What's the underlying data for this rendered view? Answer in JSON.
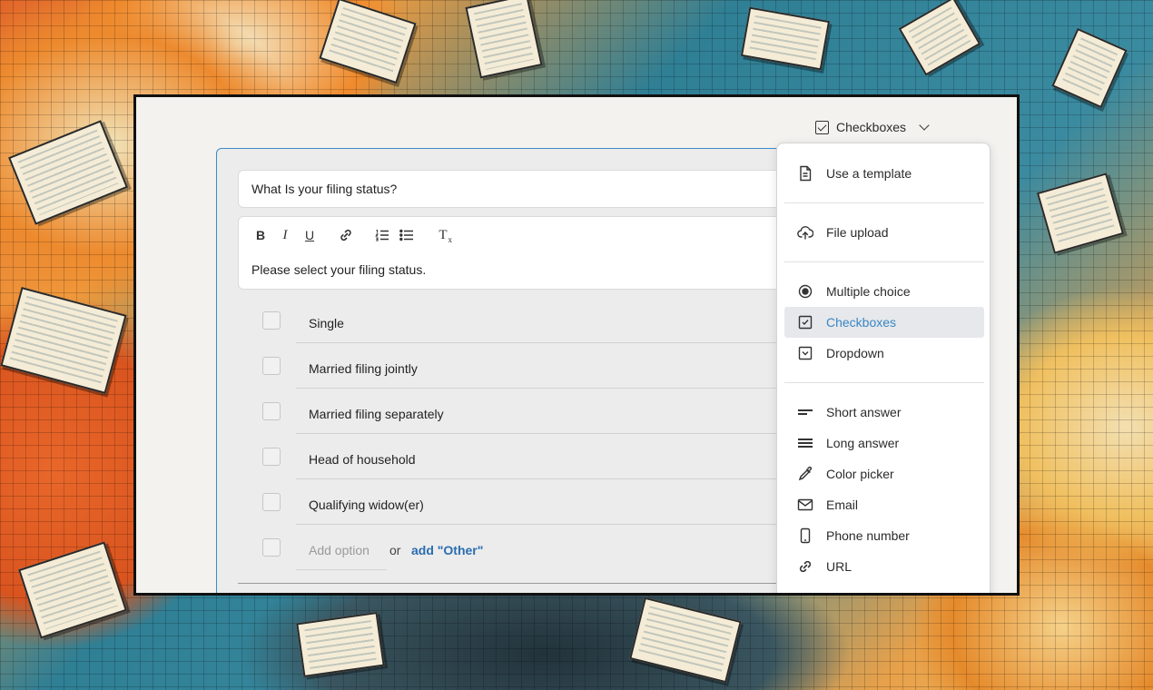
{
  "header": {
    "type_selector_label": "Checkboxes"
  },
  "question": {
    "title": "What Is your filing status?",
    "description": "Please select your filing status.",
    "toolbar": [
      "bold",
      "italic",
      "underline",
      "link",
      "numbered-list",
      "bulleted-list",
      "clear-format"
    ],
    "toolbar_glyphs": {
      "bold": "B",
      "italic": "I",
      "underline": "U",
      "clear": "T"
    }
  },
  "options": [
    {
      "label": "Single"
    },
    {
      "label": "Married filing jointly"
    },
    {
      "label": "Married filing separately"
    },
    {
      "label": "Head of household"
    },
    {
      "label": "Qualifying widow(er)"
    }
  ],
  "add_option": {
    "placeholder": "Add option",
    "or_text": "or",
    "other_link": "add \"Other\""
  },
  "menu": {
    "items": [
      {
        "label": "Use a template",
        "icon": "document-icon"
      },
      {
        "label": "File upload",
        "icon": "cloud-upload-icon"
      },
      {
        "label": "Multiple choice",
        "icon": "radio-icon"
      },
      {
        "label": "Checkboxes",
        "icon": "checkbox-icon",
        "active": true
      },
      {
        "label": "Dropdown",
        "icon": "dropdown-icon"
      },
      {
        "label": "Short answer",
        "icon": "short-text-icon"
      },
      {
        "label": "Long answer",
        "icon": "long-text-icon"
      },
      {
        "label": "Color picker",
        "icon": "eyedropper-icon"
      },
      {
        "label": "Email",
        "icon": "envelope-icon"
      },
      {
        "label": "Phone number",
        "icon": "phone-icon"
      },
      {
        "label": "URL",
        "icon": "link-icon"
      }
    ]
  },
  "colors": {
    "accent": "#3a86c4",
    "link": "#2a6db0",
    "card_border": "#3d8bc7"
  }
}
